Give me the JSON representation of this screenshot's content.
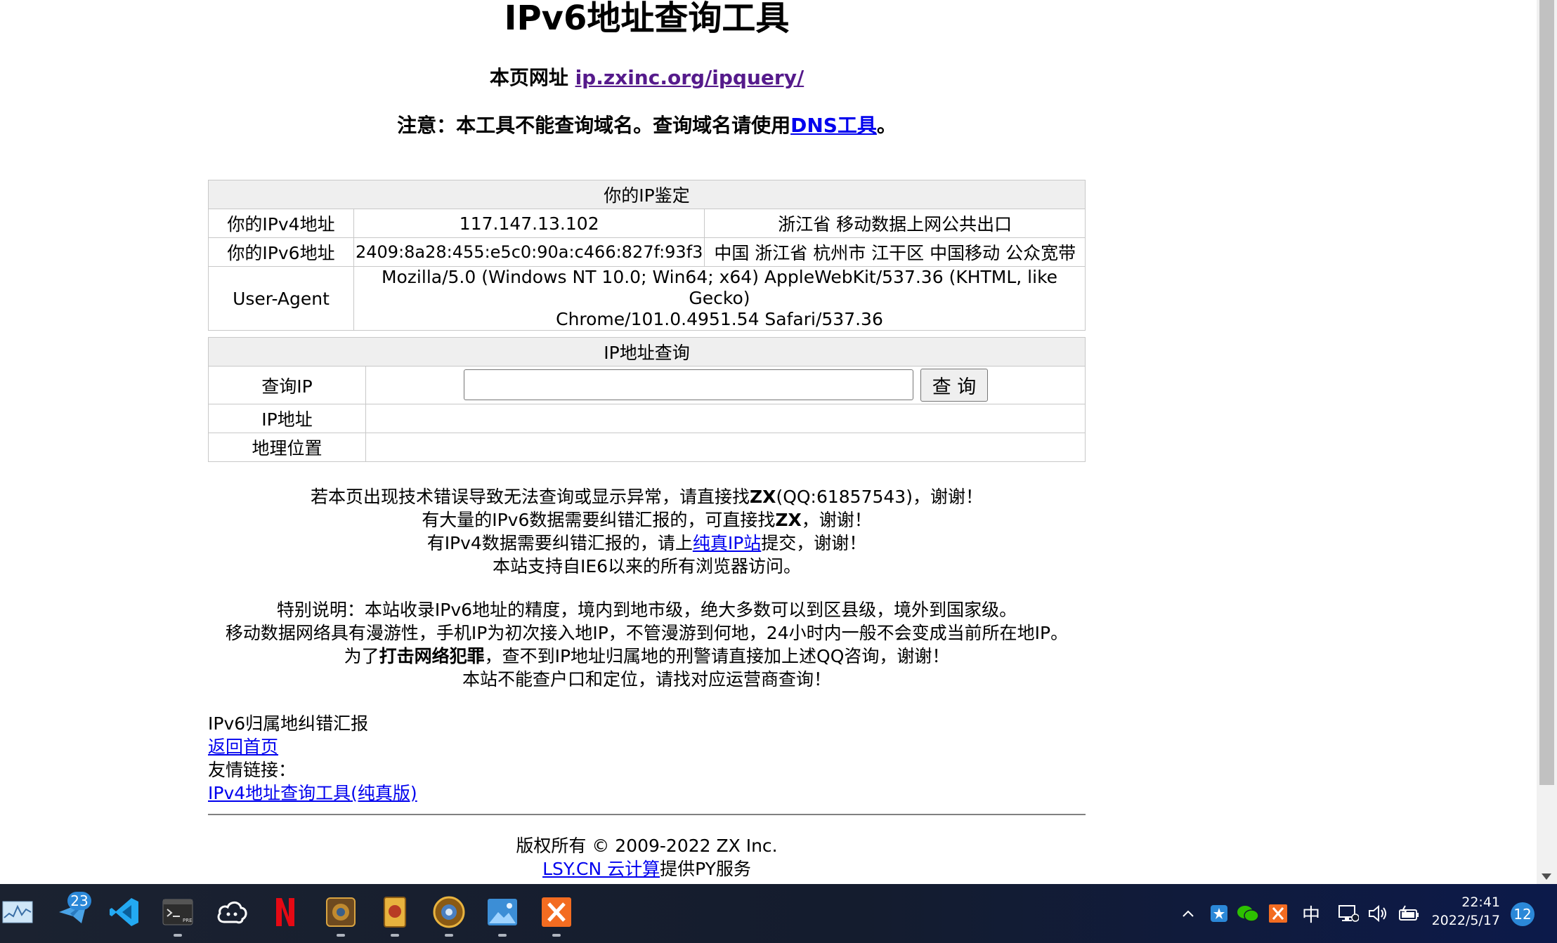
{
  "header": {
    "title": "IPv6地址查询工具",
    "page_url_label": "本页网址",
    "page_url_link": "ip.zxinc.org/ipquery/",
    "notice_prefix": "注意：本工具不能查询域名。查询域名请使用",
    "notice_link": "DNS工具",
    "notice_suffix": "。"
  },
  "ip_table": {
    "heading": "你的IP鉴定",
    "rows": [
      {
        "label": "你的IPv4地址",
        "value": "117.147.13.102",
        "location": "浙江省 移动数据上网公共出口"
      },
      {
        "label": "你的IPv6地址",
        "value": "2409:8a28:455:e5c0:90a:c466:827f:93f3",
        "location": "中国 浙江省 杭州市 江干区 中国移动 公众宽带"
      }
    ],
    "ua_label": "User-Agent",
    "ua_line1": "Mozilla/5.0 (Windows NT 10.0; Win64; x64) AppleWebKit/537.36 (KHTML, like Gecko)",
    "ua_line2": "Chrome/101.0.4951.54 Safari/537.36"
  },
  "query_table": {
    "heading": "IP地址查询",
    "query_label": "查询IP",
    "input_value": "",
    "button_label": "查 询",
    "ip_label": "IP地址",
    "ip_value": "",
    "location_label": "地理位置",
    "location_value": ""
  },
  "notes": {
    "line1_pre": "若本页出现技术错误导致无法查询或显示异常，请直接找",
    "line1_bold": "ZX",
    "line1_post": "(QQ:61857543)，谢谢！",
    "line2_pre": "有大量的IPv6数据需要纠错汇报的，可直接找",
    "line2_bold": "ZX",
    "line2_post": "，谢谢！",
    "line3_pre": "有IPv4数据需要纠错汇报的，请上",
    "line3_link": "纯真IP站",
    "line3_post": "提交，谢谢！",
    "line4": "本站支持自IE6以来的所有浏览器访问。",
    "line5": "特别说明：本站收录IPv6地址的精度，境内到地市级，绝大多数可以到区县级，境外到国家级。",
    "line6": "移动数据网络具有漫游性，手机IP为初次接入地IP，不管漫游到何地，24小时内一般不会变成当前所在地IP。",
    "line7_pre": "为了",
    "line7_bold": "打击网络犯罪",
    "line7_post": "，查不到IP地址归属地的刑警请直接加上述QQ咨询，谢谢！",
    "line8": "本站不能查户口和定位，请找对应运营商查询！"
  },
  "footer": {
    "report_text": "IPv6归属地纠错汇报",
    "home_link": "返回首页",
    "friends_label": "友情链接：",
    "friend_link": "IPv4地址查询工具(纯真版)",
    "copyright": "版权所有 © 2009-2022 ZX Inc.",
    "provider_link": "LSY.CN 云计算",
    "provider_suffix": "提供PY服务"
  },
  "taskbar": {
    "apps": [
      {
        "name": "resource-monitor-icon"
      },
      {
        "name": "mail-send-icon",
        "badge": "23"
      },
      {
        "name": "vscode-icon"
      },
      {
        "name": "terminal-preview-icon"
      },
      {
        "name": "cloud-chat-icon"
      },
      {
        "name": "netflix-icon"
      },
      {
        "name": "hearthstone-deck-icon"
      },
      {
        "name": "card-game-icon"
      },
      {
        "name": "hearthstone-icon"
      },
      {
        "name": "photos-icon"
      },
      {
        "name": "xmind-icon"
      }
    ],
    "tray": {
      "ime": "中",
      "time": "22:41",
      "date": "2022/5/17",
      "notifications": "12"
    },
    "colors": {
      "netflix": "#e50914",
      "vscode": "#23a9f2",
      "xmind": "#f36c21",
      "accent": "#2b88d8"
    }
  }
}
